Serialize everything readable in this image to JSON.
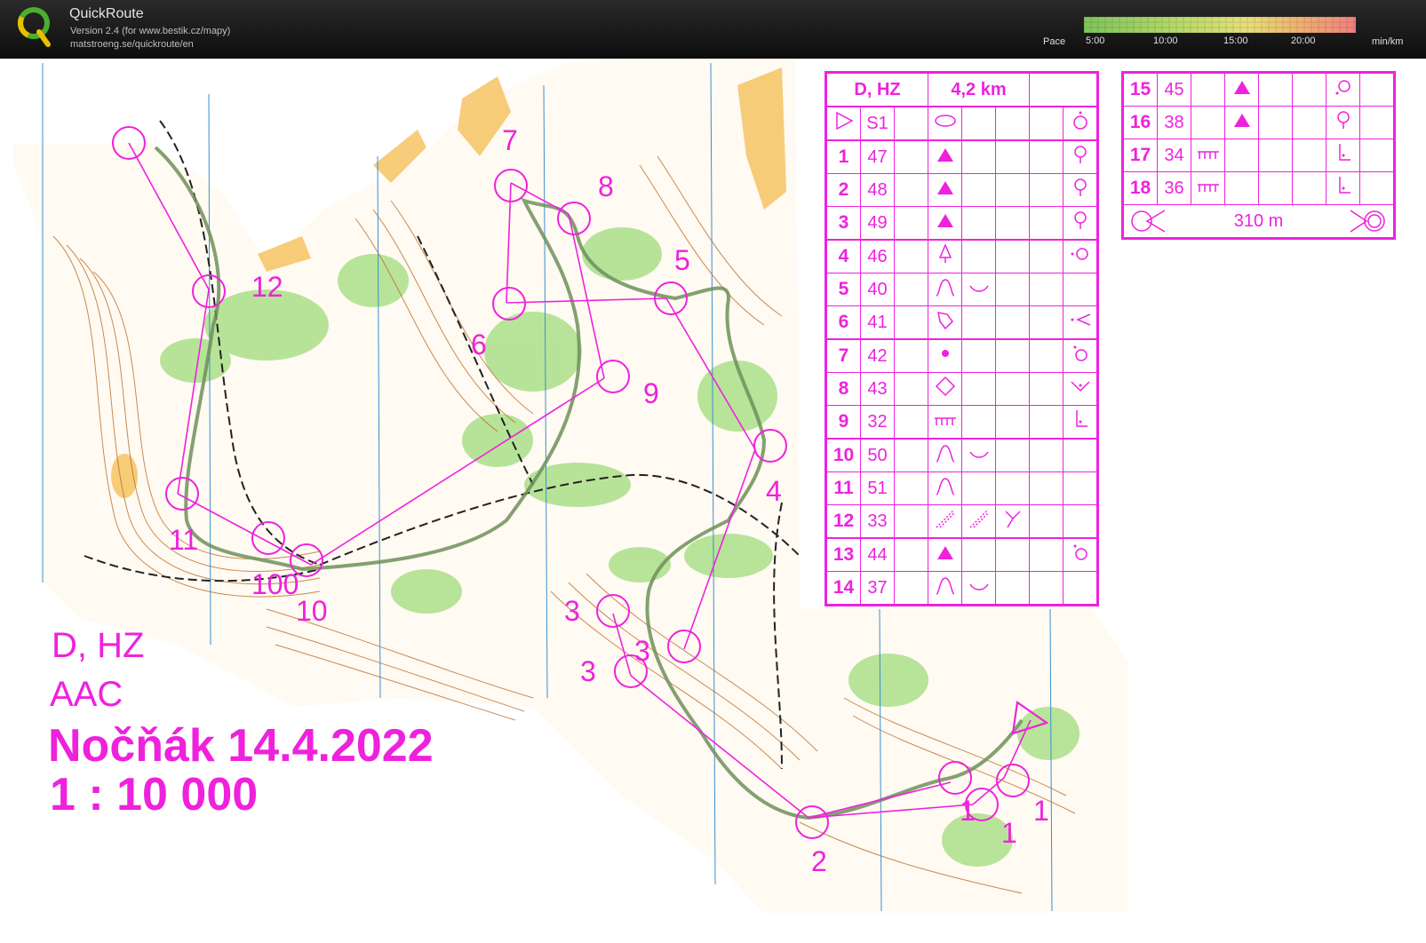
{
  "header": {
    "app_name": "QuickRoute",
    "version": "Version 2.4  (for www.bestik.cz/mapy)",
    "url": "matstroeng.se/quickroute/en",
    "pace_label": "Pace",
    "pace_ticks": [
      "5:00",
      "10:00",
      "15:00",
      "20:00"
    ],
    "pace_unit": "min/km"
  },
  "map": {
    "course": "D, HZ",
    "club": "AAC",
    "event": "Nočňák 14.4.2022",
    "scale": "1 : 10 000",
    "control_labels": [
      "12",
      "7",
      "8",
      "5",
      "6",
      "9",
      "4",
      "11",
      "100",
      "10",
      "3",
      "3",
      "3",
      "1",
      "1",
      "1",
      "2"
    ]
  },
  "description": {
    "course": "D, HZ",
    "length": "4,2 km",
    "start_code": "S1",
    "rows": [
      {
        "n": "1",
        "code": "47"
      },
      {
        "n": "2",
        "code": "48"
      },
      {
        "n": "3",
        "code": "49"
      },
      {
        "n": "4",
        "code": "46"
      },
      {
        "n": "5",
        "code": "40"
      },
      {
        "n": "6",
        "code": "41"
      },
      {
        "n": "7",
        "code": "42"
      },
      {
        "n": "8",
        "code": "43"
      },
      {
        "n": "9",
        "code": "32"
      },
      {
        "n": "10",
        "code": "50"
      },
      {
        "n": "11",
        "code": "51"
      },
      {
        "n": "12",
        "code": "33"
      },
      {
        "n": "13",
        "code": "44"
      },
      {
        "n": "14",
        "code": "37"
      }
    ],
    "rows2": [
      {
        "n": "15",
        "code": "45"
      },
      {
        "n": "16",
        "code": "38"
      },
      {
        "n": "17",
        "code": "34"
      },
      {
        "n": "18",
        "code": "36"
      }
    ],
    "finish_distance": "310 m"
  },
  "colors": {
    "course": "#ee22dd",
    "contour": "#b5651d",
    "green": "#9fdc7a",
    "title_bg": "#111111"
  }
}
